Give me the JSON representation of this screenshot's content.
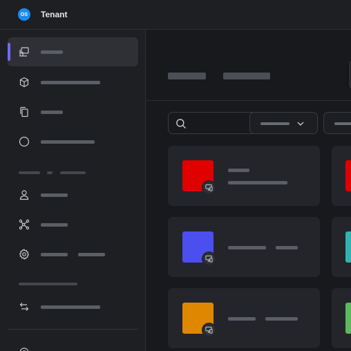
{
  "app": {
    "logo_text": "OS",
    "title": "Tenant",
    "brand_color": "#1a8cf0",
    "accent_color": "#6d6df5"
  },
  "sidebar": {
    "items": [
      {
        "icon": "layers-icon",
        "active": true
      },
      {
        "icon": "cube-icon",
        "active": false
      },
      {
        "icon": "copy-icon",
        "active": false
      },
      {
        "icon": "circle-icon",
        "active": false
      },
      {
        "icon": "user-icon",
        "active": false
      },
      {
        "icon": "network-icon",
        "active": false
      },
      {
        "icon": "gear-icon",
        "active": false
      },
      {
        "icon": "transfer-arrows-icon",
        "active": false
      }
    ]
  },
  "main": {
    "search_icon": "search-icon",
    "filter_icon": "chevron-down-icon",
    "cards": [
      {
        "color": "#e00000",
        "next_color": "#e00000",
        "badge_icon": "device-icon"
      },
      {
        "color": "#4b4ff0",
        "next_color": "#30b3b0",
        "badge_icon": "device-icon"
      },
      {
        "color": "#e08700",
        "next_color": "#5cb85c",
        "badge_icon": "device-icon"
      }
    ]
  }
}
